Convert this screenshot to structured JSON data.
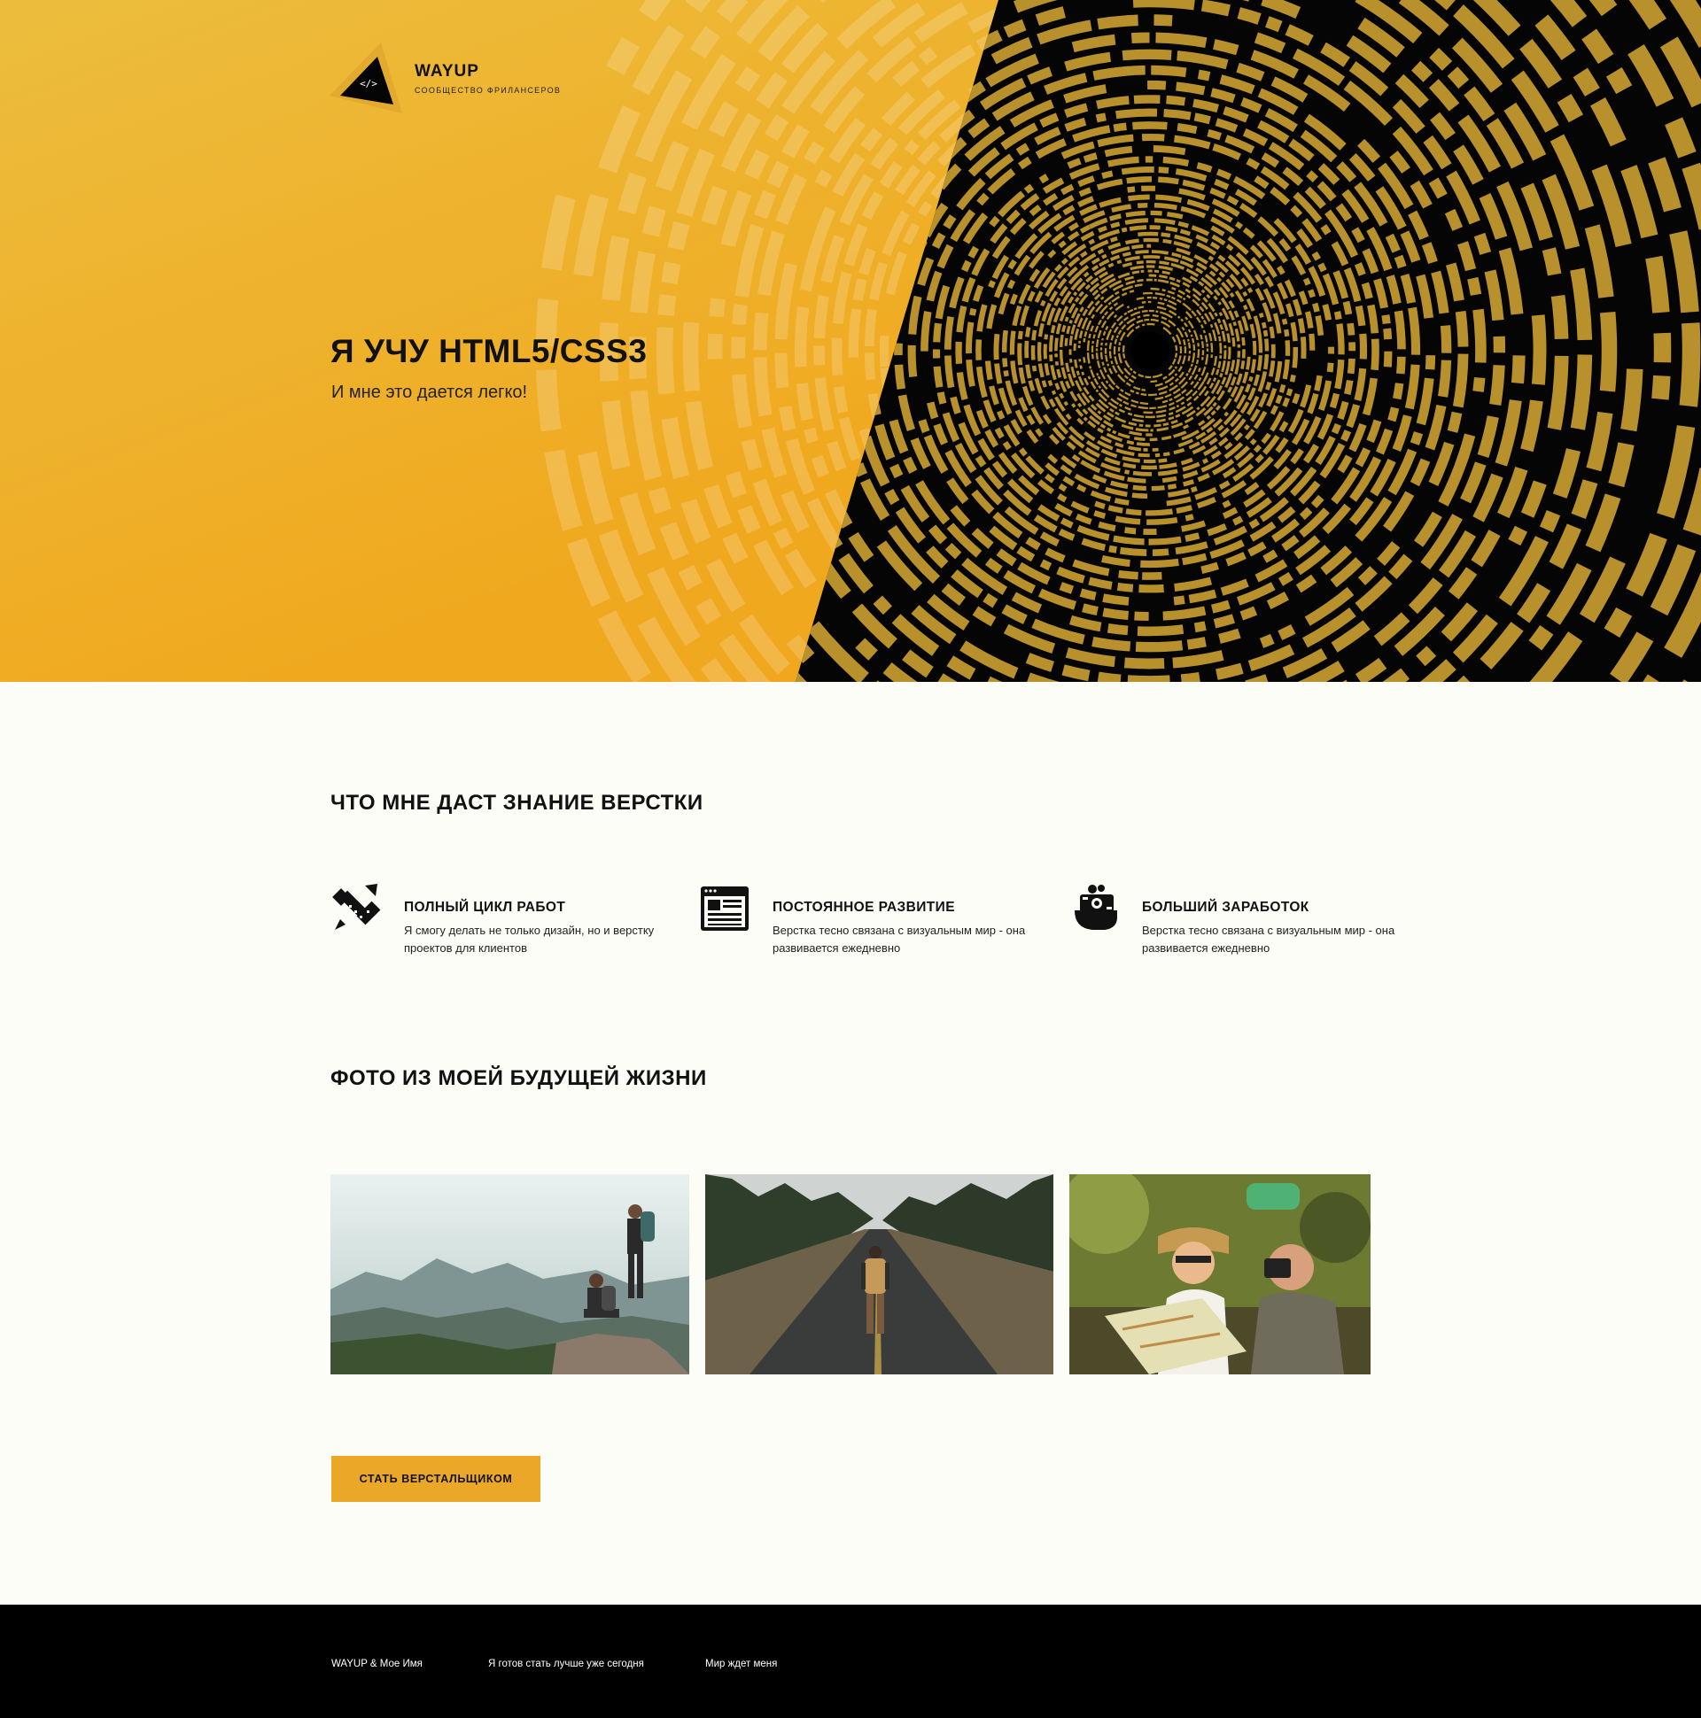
{
  "brand": {
    "name": "WAYUP",
    "tagline": "СООБЩЕСТВО ФРИЛАНСЕРОВ"
  },
  "hero": {
    "title": "Я УЧУ HTML5/CSS3",
    "subtitle": "И мне это дается легко!"
  },
  "features_section": {
    "title": "ЧТО МНЕ ДАСТ ЗНАНИЕ ВЕРСТКИ",
    "items": [
      {
        "icon": "design-tools-icon",
        "title": "ПОЛНЫЙ ЦИКЛ РАБОТ",
        "text": "Я смогу делать не только дизайн, но и верстку проектов для клиентов"
      },
      {
        "icon": "browser-layout-icon",
        "title": "ПОСТОЯННОЕ РАЗВИТИЕ",
        "text": "Верстка тесно связана с визуальным мир - она развивается ежедневно"
      },
      {
        "icon": "money-hand-icon",
        "title": "БОЛЬШИЙ ЗАРАБОТОК",
        "text": "Верстка тесно связана с визуальным мир - она развивается ежедневно"
      }
    ]
  },
  "gallery": {
    "title": "ФОТО ИЗ МОЕЙ БУДУЩЕЙ ЖИЗНИ"
  },
  "cta": {
    "label": "СТАТЬ ВЕРСТАЛЬЩИКОМ"
  },
  "footer": {
    "items": [
      "WAYUP & Мое Имя",
      "Я готов стать лучше уже сегодня",
      "Мир ждет меня"
    ]
  },
  "colors": {
    "accent": "#eaa728",
    "hero_yellow": "#efa91f",
    "dark": "#000000",
    "background": "#fdfdf8",
    "pattern_gold": "#b8902c"
  }
}
